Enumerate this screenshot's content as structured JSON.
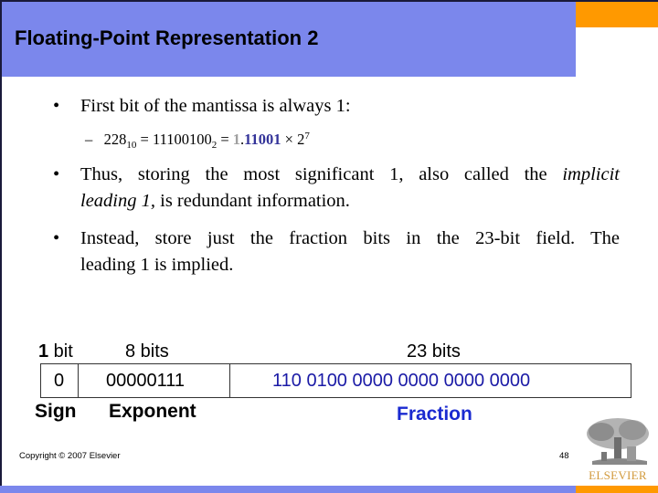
{
  "slide": {
    "title": "Floating-Point Representation 2",
    "colors": {
      "title_band": "#7b87ec",
      "accent": "#ff9900",
      "fraction_blue": "#1a1aa6",
      "highlight_bits": "#333399",
      "implicit_one_gray": "#a0a0a0"
    }
  },
  "bullets": [
    {
      "marker": "•",
      "text": "First bit of the mantissa is always 1:",
      "sub": {
        "marker": "–",
        "decimal": "228",
        "decimal_base": "10",
        "binary": "11100100",
        "binary_base": "2",
        "equals": "=",
        "implicit_one": "1",
        "point": ".",
        "fraction_bits": "11001",
        "times": "×",
        "base": "2",
        "exponent": "7"
      }
    },
    {
      "marker": "•",
      "line1_a": "Thus, storing the most significant 1, also called the ",
      "line1_em": "implicit",
      "line2_em": "leading 1,",
      "line2_b": " is redundant information."
    },
    {
      "marker": "•",
      "line1": "Instead, store just the fraction bits in the 23-bit field. The",
      "line2": "leading 1 is implied."
    }
  ],
  "diagram": {
    "widths": {
      "sign_bold": "1",
      "sign_rest": " bit",
      "exponent": "8 bits",
      "fraction": "23 bits"
    },
    "fields": {
      "sign_value": "0",
      "exponent_value": "00000111",
      "fraction_value": "110 0100 0000 0000 0000 0000"
    },
    "names": {
      "sign": "Sign",
      "exponent": "Exponent",
      "fraction": "Fraction"
    }
  },
  "footer": {
    "copyright": "Copyright © 2007 Elsevier",
    "page_number": "48",
    "logo_text": "ELSEVIER"
  }
}
